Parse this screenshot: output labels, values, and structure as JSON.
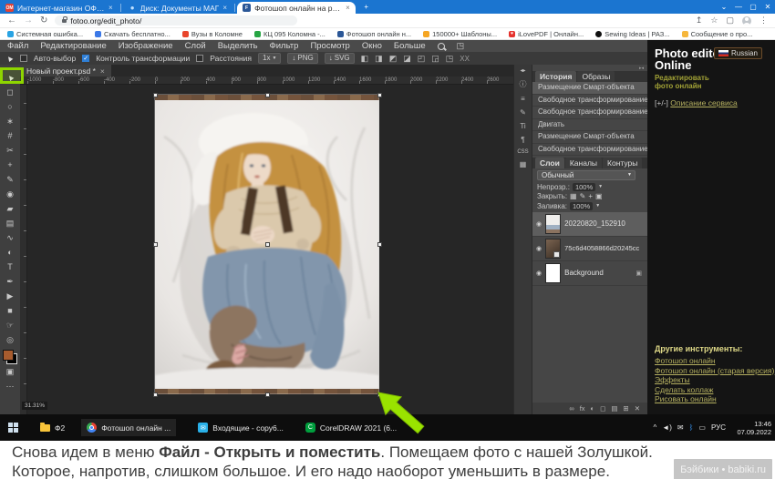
{
  "colors": {
    "chrome_blue": "#1b75d0",
    "accent_green": "#8ed500",
    "foreground_swatch": "#a85c2e"
  },
  "icons": {
    "check": "✓",
    "dropdown": "▼",
    "close": "✕",
    "close_small": "×",
    "minimize": "—",
    "restore": "▢",
    "chevron_down": "⌄",
    "back": "←",
    "forward": "→",
    "reload": "↻",
    "share": "↥",
    "star": "☆",
    "split": "▢",
    "more_v": "⋮",
    "plus": "+",
    "fullscreen": "◳",
    "collapse_lr": "◂▸",
    "collapse_rl": "▸◂",
    "eye": "◉",
    "lock": "▣",
    "down_arrow": "↓",
    "heart": "♥",
    "align_left": "◧",
    "align_center": "◨",
    "align_right": "◩",
    "distribute": "◪",
    "frame1": "◰",
    "frame2": "◲",
    "frame3": "◳",
    "tray_up": "^",
    "tray_volume": "◄)",
    "tray_mail": "✉",
    "tray_bluetooth": "ᛒ",
    "tray_display": "▭"
  },
  "browser": {
    "tabs": [
      {
        "label": "Интернет-магазин ОФИСМАГ",
        "favicon": "ОМ"
      },
      {
        "label": "Диск: Документы МАГ"
      },
      {
        "label": "Фотошоп онлайн на русском |",
        "favicon": "F"
      }
    ],
    "url": "fotoo.org/edit_photo/",
    "bookmarks": [
      {
        "label": "Системная ошибка..."
      },
      {
        "label": "Скачать бесплатно..."
      },
      {
        "label": "Вузы в Коломне"
      },
      {
        "label": "КЦ 095 Коломна -..."
      },
      {
        "label": "Фотошоп онлайн н..."
      },
      {
        "label": "150000+ Шаблоны..."
      },
      {
        "label": "iLovePDF | Онлайн..."
      },
      {
        "label": "Sewing Ideas | РАЗ..."
      },
      {
        "label": "Сообщение о про..."
      }
    ]
  },
  "editor": {
    "menu": [
      "Файл",
      "Редактирование",
      "Изображение",
      "Слой",
      "Выделить",
      "Фильтр",
      "Просмотр",
      "Окно",
      "Больше"
    ],
    "options": {
      "auto_select": "Авто-выбор",
      "transform_controls": "Контроль трансформации",
      "distances": "Расстояния",
      "scale": "1x",
      "png": "PNG",
      "svg": "SVG",
      "xx": "XX"
    },
    "doc_tab": "Новый проект.psd *",
    "zoom_status": "31.31%",
    "ruler": [
      "-1000",
      "-800",
      "-600",
      "-400",
      "-200",
      "0",
      "200",
      "400",
      "600",
      "800",
      "1000",
      "1200",
      "1400",
      "1600",
      "1800",
      "2000",
      "2200",
      "2400",
      "2600"
    ],
    "tools": [
      {
        "name": "move",
        "glyph": "▲"
      },
      {
        "name": "marquee",
        "glyph": "◻"
      },
      {
        "name": "lasso",
        "glyph": "○"
      },
      {
        "name": "magic-wand",
        "glyph": "∗"
      },
      {
        "name": "crop",
        "glyph": "#"
      },
      {
        "name": "slice",
        "glyph": "✂"
      },
      {
        "name": "healing",
        "glyph": "+"
      },
      {
        "name": "brush",
        "glyph": "✎"
      },
      {
        "name": "clone-stamp",
        "glyph": "◉"
      },
      {
        "name": "eraser",
        "glyph": "▰"
      },
      {
        "name": "gradient",
        "glyph": "▤"
      },
      {
        "name": "smudge",
        "glyph": "∿"
      },
      {
        "name": "dodge",
        "glyph": "◐"
      },
      {
        "name": "type",
        "glyph": "T"
      },
      {
        "name": "pen",
        "glyph": "✒"
      },
      {
        "name": "path-select",
        "glyph": "▶"
      },
      {
        "name": "shape",
        "glyph": "■"
      },
      {
        "name": "hand",
        "glyph": "☞"
      },
      {
        "name": "zoom",
        "glyph": "◎"
      }
    ],
    "extra_tools": [
      {
        "glyph": "▣"
      },
      {
        "glyph": "⋯"
      }
    ]
  },
  "panel_strip": [
    {
      "name": "info",
      "glyph": "ⓘ"
    },
    {
      "name": "adjustments",
      "glyph": "≡"
    },
    {
      "name": "paint",
      "glyph": "✎"
    },
    {
      "name": "character",
      "glyph": "Ti"
    },
    {
      "name": "paragraph",
      "glyph": "¶"
    },
    {
      "name": "css",
      "glyph": "CSS"
    },
    {
      "name": "image",
      "glyph": "▦"
    }
  ],
  "panels": {
    "history": {
      "tabs": [
        "История",
        "Образы"
      ],
      "items": [
        "Размещение Смарт-объекта",
        "Свободное трансформирование",
        "Свободное трансформирование",
        "Двигать",
        "Размещение Смарт-объекта",
        "Свободное трансформирование"
      ]
    },
    "layers": {
      "tabs": [
        "Слои",
        "Каналы",
        "Контуры"
      ],
      "blend_mode": "Обычный",
      "opacity_label": "Непрозр.:",
      "opacity_value": "100%",
      "lock_label": "Закрыть:",
      "lock_icons": [
        "▦",
        "✎",
        "+",
        "▣"
      ],
      "fill_label": "Заливка:",
      "fill_value": "100%",
      "rows": [
        {
          "name": "20220820_152910"
        },
        {
          "name": "75c6d4058866d20245cc"
        },
        {
          "name": "Background"
        }
      ],
      "bottom_icons": [
        {
          "name": "link",
          "glyph": "∞"
        },
        {
          "name": "effects",
          "glyph": "fx"
        },
        {
          "name": "adjustment",
          "glyph": "◐"
        },
        {
          "name": "mask",
          "glyph": "◻"
        },
        {
          "name": "group",
          "glyph": "▤"
        },
        {
          "name": "new-layer",
          "glyph": "⊞"
        },
        {
          "name": "delete",
          "glyph": "✕"
        }
      ]
    }
  },
  "sidebar": {
    "title_line1": "Photo editor",
    "title_line2": "Online",
    "language_button": "Russian",
    "tagline": "Редактировать фото онлайн",
    "description_prefix": "[+/-]",
    "description_link": "Описание сервиса",
    "other_tools_header": "Другие инструменты:",
    "other_tools": [
      "Фотошоп онлайн",
      "Фотошоп онлайн (старая версия)",
      "Эффекты",
      "Сделать коллаж",
      "Рисовать онлайн"
    ]
  },
  "taskbar": {
    "apps": [
      {
        "label": "Ф2"
      },
      {
        "label": "Фотошоп онлайн ..."
      },
      {
        "label": "Входящие - сору6..."
      },
      {
        "label": "CorelDRAW 2021 (6..."
      }
    ],
    "tray": {
      "lang": "РУС",
      "time": "13:46",
      "date": "07.09.2022"
    }
  },
  "caption": {
    "line1_prefix": "Снова идем в меню ",
    "line1_bold": "Файл - Открыть и поместить",
    "line1_suffix": ". Помещаем фото с нашей Золушкой.",
    "line2": "Которое, напротив, слишком большое. И его надо наоборот уменьшить в размере.",
    "watermark": "Бэйбики • babiki.ru"
  }
}
